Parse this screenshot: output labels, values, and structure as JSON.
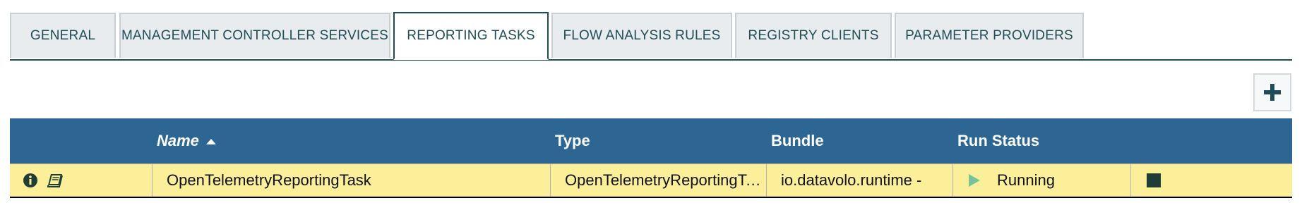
{
  "tabs": [
    {
      "label": "GENERAL"
    },
    {
      "label": "MANAGEMENT CONTROLLER SERVICES"
    },
    {
      "label": "REPORTING TASKS"
    },
    {
      "label": "FLOW ANALYSIS RULES"
    },
    {
      "label": "REGISTRY CLIENTS"
    },
    {
      "label": "PARAMETER PROVIDERS"
    }
  ],
  "active_tab": "REPORTING TASKS",
  "toolbar": {
    "add_icon": "plus-icon"
  },
  "table": {
    "columns": {
      "name": "Name",
      "type": "Type",
      "bundle": "Bundle",
      "run_status": "Run Status"
    },
    "sort": {
      "column": "Name",
      "direction": "ascending"
    },
    "rows": [
      {
        "name": "OpenTelemetryReportingTask",
        "type": "OpenTelemetryReportingTask",
        "bundle": "io.datavolo.runtime - ",
        "run_status": "Running",
        "icons": [
          "info-icon",
          "book-icon",
          "play-icon",
          "stop-icon"
        ]
      }
    ]
  },
  "colors": {
    "header_bg": "#2d6693",
    "row_highlight": "#fcef9a",
    "tab_text": "#1f4c56",
    "running_green": "#77c29d"
  }
}
